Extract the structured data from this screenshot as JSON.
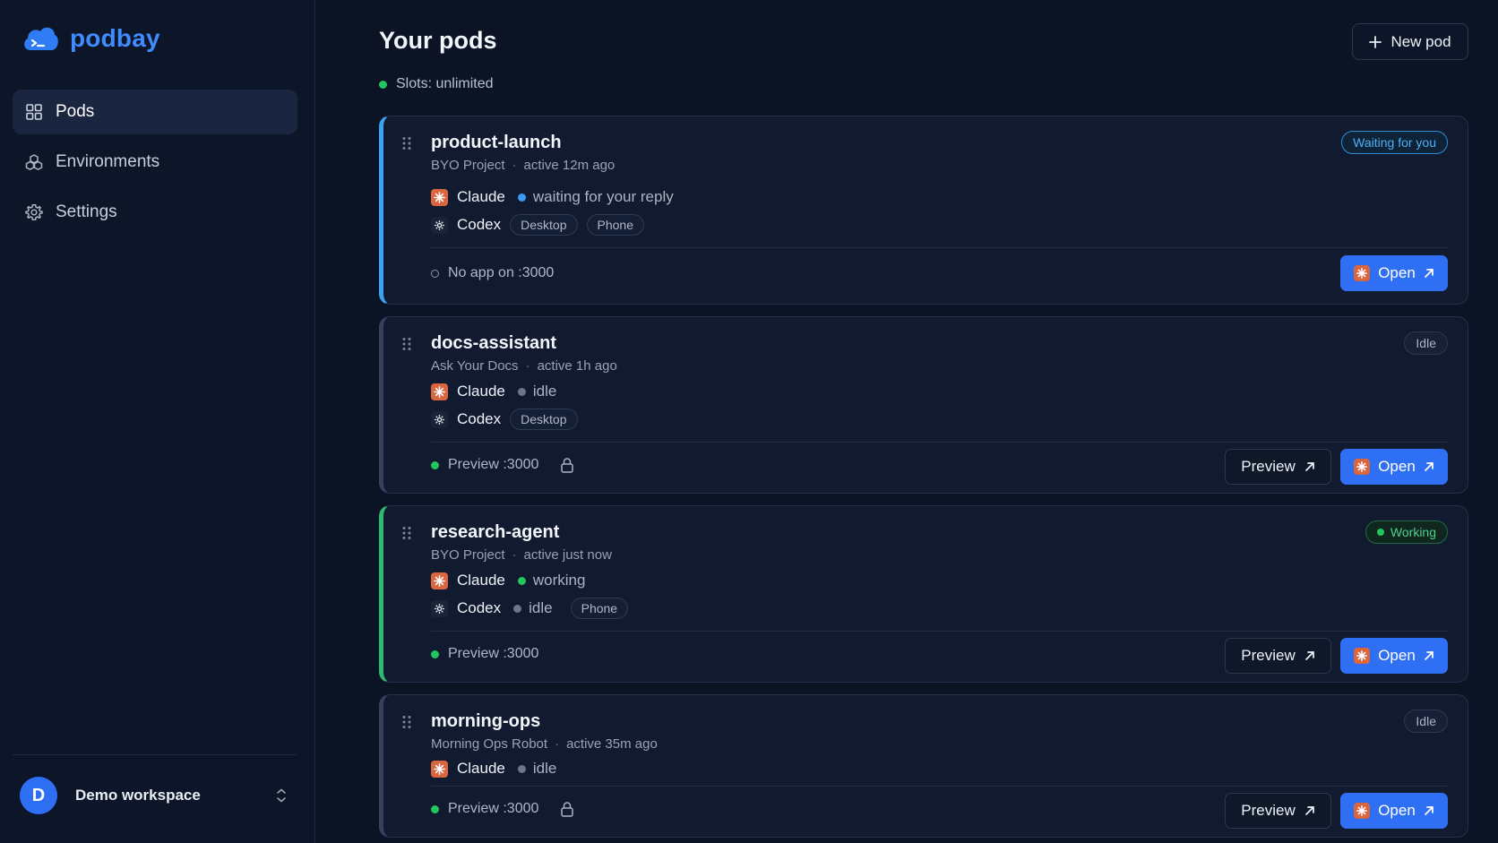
{
  "app": {
    "name": "podbay"
  },
  "sidebar": {
    "items": [
      {
        "label": "Pods",
        "icon": "grid-icon",
        "active": true
      },
      {
        "label": "Environments",
        "icon": "cubes-icon",
        "active": false
      },
      {
        "label": "Settings",
        "icon": "gear-icon",
        "active": false
      }
    ],
    "workspace": {
      "initial": "D",
      "name": "Demo workspace"
    }
  },
  "header": {
    "title": "Your pods",
    "slots": "Slots: unlimited",
    "new_pod_label": "New pod"
  },
  "pods": [
    {
      "name": "product-launch",
      "project": "BYO Project",
      "activity": "active 12m ago",
      "badge": "Waiting for you",
      "claude_status": "waiting for your reply",
      "codex_chips": [
        "Desktop",
        "Phone"
      ],
      "footer": "No app on :3000",
      "open_label": "Open"
    },
    {
      "name": "docs-assistant",
      "project": "Ask Your Docs",
      "activity": "active 1h ago",
      "badge": "Idle",
      "claude_status": "idle",
      "codex_chips": [
        "Desktop"
      ],
      "footer": "Preview :3000",
      "preview_label": "Preview",
      "open_label": "Open"
    },
    {
      "name": "research-agent",
      "project": "BYO Project",
      "activity": "active just now",
      "badge": "Working",
      "claude_status": "working",
      "codex_status": "idle",
      "codex_chips": [
        "Phone"
      ],
      "footer": "Preview :3000",
      "preview_label": "Preview",
      "open_label": "Open"
    },
    {
      "name": "morning-ops",
      "project": "Morning Ops Robot",
      "activity": "active 35m ago",
      "badge": "Idle",
      "claude_status": "idle",
      "footer": "Preview :3000",
      "preview_label": "Preview",
      "open_label": "Open"
    }
  ],
  "agents": {
    "claude": "Claude",
    "codex": "Codex"
  },
  "colors": {
    "accent": "#2f6ff3",
    "waiting": "#3aa3f2",
    "working": "#2fb872",
    "claude": "#d9663f"
  }
}
